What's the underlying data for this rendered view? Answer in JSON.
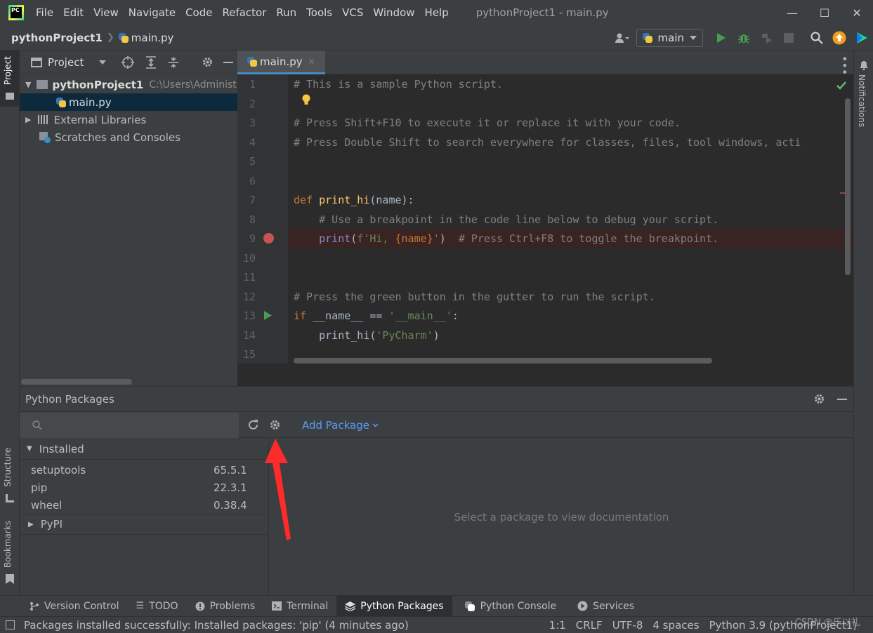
{
  "app": {
    "logo_text": "PC",
    "menu": [
      "File",
      "Edit",
      "View",
      "Navigate",
      "Code",
      "Refactor",
      "Run",
      "Tools",
      "VCS",
      "Window",
      "Help"
    ],
    "window_title": "pythonProject1 - main.py",
    "window_controls": {
      "minimize": "—",
      "maximize": "☐",
      "close": "✕"
    }
  },
  "navbar": {
    "project": "pythonProject1",
    "file": "main.py",
    "run_config": "main",
    "icons": [
      "user-icon",
      "run-icon",
      "debug-icon",
      "coverage-icon",
      "stop-icon",
      "search-icon",
      "update-icon",
      "toolbox-icon"
    ]
  },
  "left_stripe": {
    "project_tab": "Project",
    "structure_tab": "Structure",
    "bookmarks_tab": "Bookmarks"
  },
  "right_stripe": {
    "notifications_tab": "Notifications"
  },
  "project_panel": {
    "title": "Project",
    "tree": [
      {
        "label": "pythonProject1",
        "path": "C:\\Users\\Administ",
        "level": 0,
        "expanded": true
      },
      {
        "label": "main.py",
        "level": 1,
        "selected": true
      },
      {
        "label": "External Libraries",
        "level": 0,
        "expanded": false
      },
      {
        "label": "Scratches and Consoles",
        "level": 0
      }
    ]
  },
  "editor": {
    "tab": "main.py",
    "line_numbers": [
      "1",
      "2",
      "3",
      "4",
      "5",
      "6",
      "7",
      "8",
      "9",
      "10",
      "11",
      "12",
      "13",
      "14",
      "15"
    ],
    "lines": {
      "l1": "# This is a sample Python script.",
      "l3": "# Press Shift+F10 to execute it or replace it with your code.",
      "l4": "# Press Double Shift to search everywhere for classes, files, tool windows, acti",
      "l7_kw": "def ",
      "l7_fn": "print_hi",
      "l7_rest": "(name):",
      "l8": "    # Use a breakpoint in the code line below to debug your script.",
      "l9_bi": "    print",
      "l9_a": "(",
      "l9_str1": "f'Hi, ",
      "l9_brace": "{name}",
      "l9_str2": "'",
      "l9_b": ")  ",
      "l9_cm": "# Press Ctrl+F8 to toggle the breakpoint.",
      "l12": "# Press the green button in the gutter to run the script.",
      "l13_kw": "if ",
      "l13_mid": "__name__ == ",
      "l13_str": "'__main__'",
      "l13_end": ":",
      "l14_a": "    print_hi(",
      "l14_str": "'PyCharm'",
      "l14_b": ")"
    }
  },
  "packages": {
    "title": "Python Packages",
    "add_package": "Add Package",
    "installed_label": "Installed",
    "installed": [
      {
        "name": "setuptools",
        "version": "65.5.1"
      },
      {
        "name": "pip",
        "version": "22.3.1"
      },
      {
        "name": "wheel",
        "version": "0.38.4"
      }
    ],
    "pypi_label": "PyPI",
    "doc_placeholder": "Select a package to view documentation"
  },
  "tool_tabs": [
    {
      "label": "Version Control",
      "icon": "branch-icon",
      "active": false
    },
    {
      "label": "TODO",
      "icon": "list-icon",
      "active": false
    },
    {
      "label": "Problems",
      "icon": "info-icon",
      "active": false
    },
    {
      "label": "Terminal",
      "icon": "terminal-icon",
      "active": false
    },
    {
      "label": "Python Packages",
      "icon": "layers-icon",
      "active": true
    },
    {
      "label": "Python Console",
      "icon": "python-icon",
      "active": false
    },
    {
      "label": "Services",
      "icon": "services-icon",
      "active": false
    }
  ],
  "status": {
    "message": "Packages installed successfully: Installed packages: 'pip' (4 minutes ago)",
    "position": "1:1",
    "line_sep": "CRLF",
    "encoding": "UTF-8",
    "indent": "4 spaces",
    "interpreter": "Python 3.9 (pythonProject1)"
  },
  "watermark": "CSDN @乐以礼",
  "colors": {
    "accent": "#4a88c7",
    "run": "#499c54",
    "breakpoint": "#c75450",
    "arrow": "#ff2a2a"
  }
}
